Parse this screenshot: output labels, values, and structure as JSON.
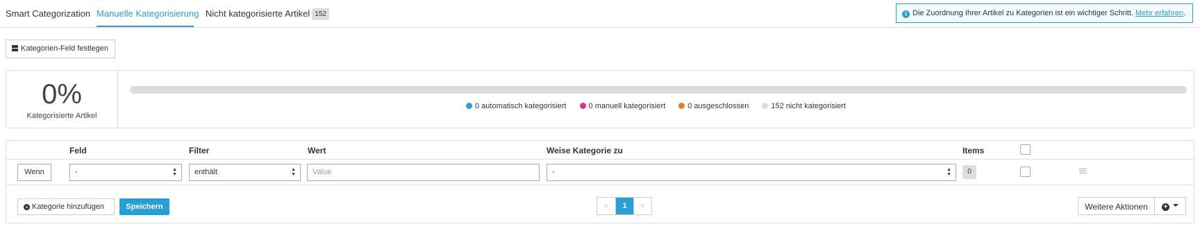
{
  "tabs": [
    {
      "label": "Smart Categorization",
      "active": false
    },
    {
      "label": "Manuelle Kategorisierung",
      "active": true
    },
    {
      "label": "Nicht kategorisierte Artikel",
      "badge": "152",
      "active": false
    }
  ],
  "info": {
    "text": "Die Zuordnung Ihrer Artikel zu Kategorien ist ein wichtiger Schritt.",
    "link": "Mehr erfahren",
    "suffix": "."
  },
  "toolbar": {
    "set_field_label": "Kategorien-Feld festlegen"
  },
  "stats": {
    "percent": "0%",
    "label": "Kategorisierte Artikel",
    "progress_fraction": 0,
    "legend": [
      {
        "label": "0 automatisch kategorisiert",
        "color": "#2a9fd6"
      },
      {
        "label": "0 manuell kategorisiert",
        "color": "#d63384"
      },
      {
        "label": "0 ausgeschlossen",
        "color": "#e67e22"
      },
      {
        "label": "152 nicht kategorisiert",
        "color": "#dddddd"
      }
    ]
  },
  "rules": {
    "headers": {
      "field": "Feld",
      "filter": "Filter",
      "value": "Wert",
      "category": "Weise Kategorie zu",
      "items": "Items"
    },
    "row": {
      "condition": "Wenn",
      "field": "-",
      "filter": "enthält",
      "value_placeholder": "Value",
      "category": "-",
      "count": "0"
    },
    "add_label": "Kategorie hinzufügen",
    "save_label": "Speichern",
    "pager": {
      "prev": "«",
      "current": "1",
      "next": "»"
    },
    "more_actions_label": "Weitere Aktionen"
  },
  "colors": {
    "accent": "#2a9fd6",
    "border": "#dddddd"
  }
}
